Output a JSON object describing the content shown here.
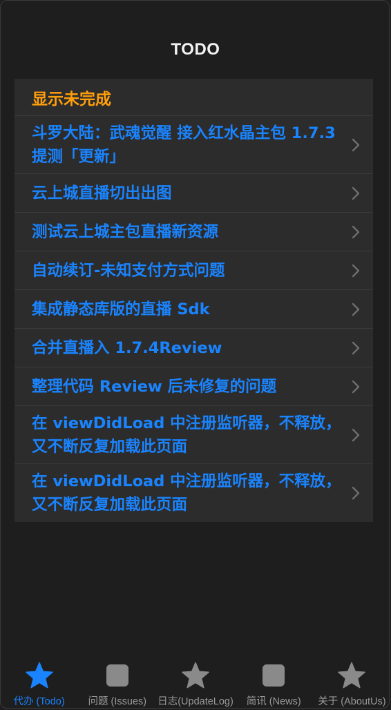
{
  "nav": {
    "title": "TODO"
  },
  "list": {
    "header": "显示未完成",
    "items": [
      {
        "label": "斗罗大陆：武魂觉醒 接入红水晶主包 1.7.3 提测「更新」"
      },
      {
        "label": "云上城直播切出出图"
      },
      {
        "label": "测试云上城主包直播新资源"
      },
      {
        "label": "自动续订-未知支付方式问题"
      },
      {
        "label": "集成静态库版的直播 Sdk"
      },
      {
        "label": "合并直播入 1.7.4Review"
      },
      {
        "label": "整理代码 Review 后未修复的问题"
      },
      {
        "label": "在 viewDidLoad 中注册监听器，不释放，又不断反复加载此页面"
      },
      {
        "label": "在 viewDidLoad 中注册监听器，不释放，又不断反复加载此页面"
      }
    ]
  },
  "tabbar": {
    "tabs": [
      {
        "label": "代办 (Todo)",
        "icon": "star-icon",
        "active": true
      },
      {
        "label": "问题 (Issues)",
        "icon": "square-icon",
        "active": false
      },
      {
        "label": "日志(UpdateLog)",
        "icon": "star-icon",
        "active": false
      },
      {
        "label": "简讯 (News)",
        "icon": "square-icon",
        "active": false
      },
      {
        "label": "关于 (AboutUs)",
        "icon": "star-icon",
        "active": false
      }
    ]
  },
  "colors": {
    "background": "#1e1e1e",
    "cell_background": "#2c2c2c",
    "accent_blue": "#1a84ff",
    "accent_orange": "#ff9f0a",
    "inactive_gray": "#8a8a8a"
  }
}
